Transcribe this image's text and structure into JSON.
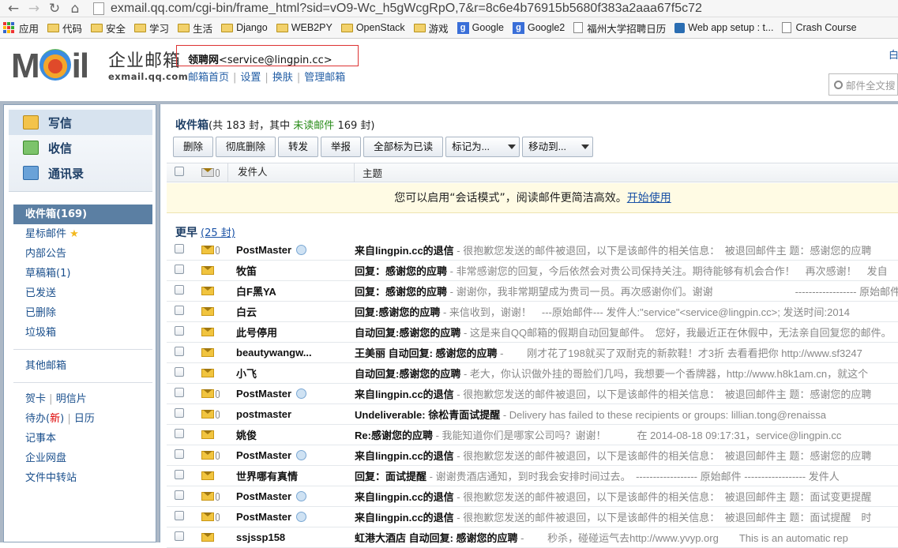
{
  "browser": {
    "url": "exmail.qq.com/cgi-bin/frame_html?sid=vO9-Wc_h5gWcgRpO,7&r=8c6e4b76915b5680f383a2aaa67f5c72",
    "bookmarks": [
      "应用",
      "代码",
      "安全",
      "学习",
      "生活",
      "Django",
      "WEB2PY",
      "OpenStack",
      "游戏",
      "Google",
      "Google2",
      "福州大学招聘日历",
      "Web app setup : t...",
      "Crash Course"
    ]
  },
  "header": {
    "logo_text": "MOil",
    "brand_cn": "企业邮箱",
    "brand_en": "exmail.qq.com",
    "user_name": "领聘网",
    "user_email": "<service@lingpin.cc>",
    "links": [
      "邮箱首页",
      "设置",
      "换肤",
      "管理邮箱"
    ],
    "search_placeholder": "邮件全文搜",
    "top_right": "白"
  },
  "sidebar": {
    "actions": [
      "写信",
      "收信",
      "通讯录"
    ],
    "folders": [
      {
        "label": "收件箱(169)",
        "active": true
      },
      {
        "label": "星标邮件"
      },
      {
        "label": "内部公告"
      },
      {
        "label": "草稿箱(1)"
      },
      {
        "label": "已发送"
      },
      {
        "label": "已删除"
      },
      {
        "label": "垃圾箱"
      }
    ],
    "other": "其他邮箱",
    "extras_row1": [
      "贺卡",
      "明信片"
    ],
    "todo": "待办(",
    "todo_new": "新",
    "todo_close": ")",
    "calendar": "日历",
    "notes": "记事本",
    "disk": "企业网盘",
    "transfer": "文件中转站"
  },
  "main": {
    "title": "收件箱",
    "count_prefix": "(共 183 封，其中 ",
    "unread_label": "未读邮件",
    "count_suffix": " 169 封)",
    "toolbar": [
      "删除",
      "彻底删除",
      "转发",
      "举报",
      "全部标为已读"
    ],
    "mark_as": "标记为...",
    "move_to": "移动到...",
    "col_from": "发件人",
    "col_subject": "主题",
    "notice_text": "您可以启用“会话模式”，阅读邮件更简洁高效。",
    "notice_link": "开始使用",
    "group_label": "更早",
    "group_count": "(25 封)",
    "rows": [
      {
        "from": "PostMaster",
        "qq": true,
        "clip": true,
        "subject": "来自lingpin.cc的退信",
        "preview": " - 很抱歉您发送的邮件被退回，以下是该邮件的相关信息：　被退回邮件主 题：感谢您的应聘"
      },
      {
        "from": "牧笛",
        "qq": false,
        "clip": false,
        "subject": "回复：感谢您的应聘",
        "preview": " - 非常感谢您的回复，今后依然会对贵公司保持关注。期待能够有机会合作！　再次感谢！　发自"
      },
      {
        "from": "白F黑YA",
        "qq": false,
        "clip": false,
        "subject": "回复：感谢您的应聘",
        "preview": " - 谢谢你，我非常期望成为贵司一员。再次感谢你们。谢谢　　　　　　　　------------------ 原始邮件 ------"
      },
      {
        "from": "白云",
        "qq": false,
        "clip": false,
        "subject": "回复:感谢您的应聘",
        "preview": " - 来信收到，谢谢！　---原始邮件--- 发件人:\"service\"<service@lingpin.cc>; 发送时间:2014"
      },
      {
        "from": "此号停用",
        "qq": false,
        "clip": false,
        "subject": "自动回复:感谢您的应聘",
        "preview": " - 这是来自QQ邮箱的假期自动回复邮件。　您好，我最近正在休假中，无法亲自回复您的邮件。"
      },
      {
        "from": "beautywangw...",
        "qq": false,
        "clip": false,
        "subject": "王美丽 自动回复: 感谢您的应聘",
        "preview": " - 　　刚才花了198就买了双耐克的新款鞋！才3折 去看看把你 http://www.sf3247"
      },
      {
        "from": "小飞",
        "qq": false,
        "clip": false,
        "subject": "自动回复:感谢您的应聘",
        "preview": " - 老大，你认识做外挂的哥脸们几吗，我想要一个香牌器，http://www.h8k1am.cn，就这个"
      },
      {
        "from": "PostMaster",
        "qq": true,
        "clip": true,
        "subject": "来自lingpin.cc的退信",
        "preview": " - 很抱歉您发送的邮件被退回，以下是该邮件的相关信息：　被退回邮件主 题：感谢您的应聘"
      },
      {
        "from": "postmaster",
        "qq": false,
        "clip": true,
        "subject": "Undeliverable: 徐松青面试提醒",
        "preview": " - Delivery has failed to these recipients or groups: lillian.tong@renaissa"
      },
      {
        "from": "姚俊",
        "qq": false,
        "clip": false,
        "subject": "Re:感谢您的应聘",
        "preview": " - 我能知道你们是哪家公司吗？谢谢！　　　在 2014-08-18 09:17:31，service@lingpin.cc"
      },
      {
        "from": "PostMaster",
        "qq": true,
        "clip": true,
        "subject": "来自lingpin.cc的退信",
        "preview": " - 很抱歉您发送的邮件被退回，以下是该邮件的相关信息：　被退回邮件主 题：感谢您的应聘"
      },
      {
        "from": "世界哪有真情",
        "qq": false,
        "clip": false,
        "subject": "回复：面试提醒",
        "preview": " - 谢谢贵酒店通知，到时我会安排时间过去。　------------------ 原始邮件 ------------------ 发件人"
      },
      {
        "from": "PostMaster",
        "qq": true,
        "clip": true,
        "subject": "来自lingpin.cc的退信",
        "preview": " - 很抱歉您发送的邮件被退回，以下是该邮件的相关信息：　被退回邮件主 题：面试变更提醒"
      },
      {
        "from": "PostMaster",
        "qq": true,
        "clip": true,
        "subject": "来自lingpin.cc的退信",
        "preview": " - 很抱歉您发送的邮件被退回，以下是该邮件的相关信息：　被退回邮件主 题：面试提醒　时"
      },
      {
        "from": "ssjssp158",
        "qq": false,
        "clip": false,
        "subject": "虹港大酒店 自动回复: 感谢您的应聘",
        "preview": " - 　　秒杀，碰碰运气去http://www.yvyp.org　　This is an automatic rep"
      }
    ]
  }
}
